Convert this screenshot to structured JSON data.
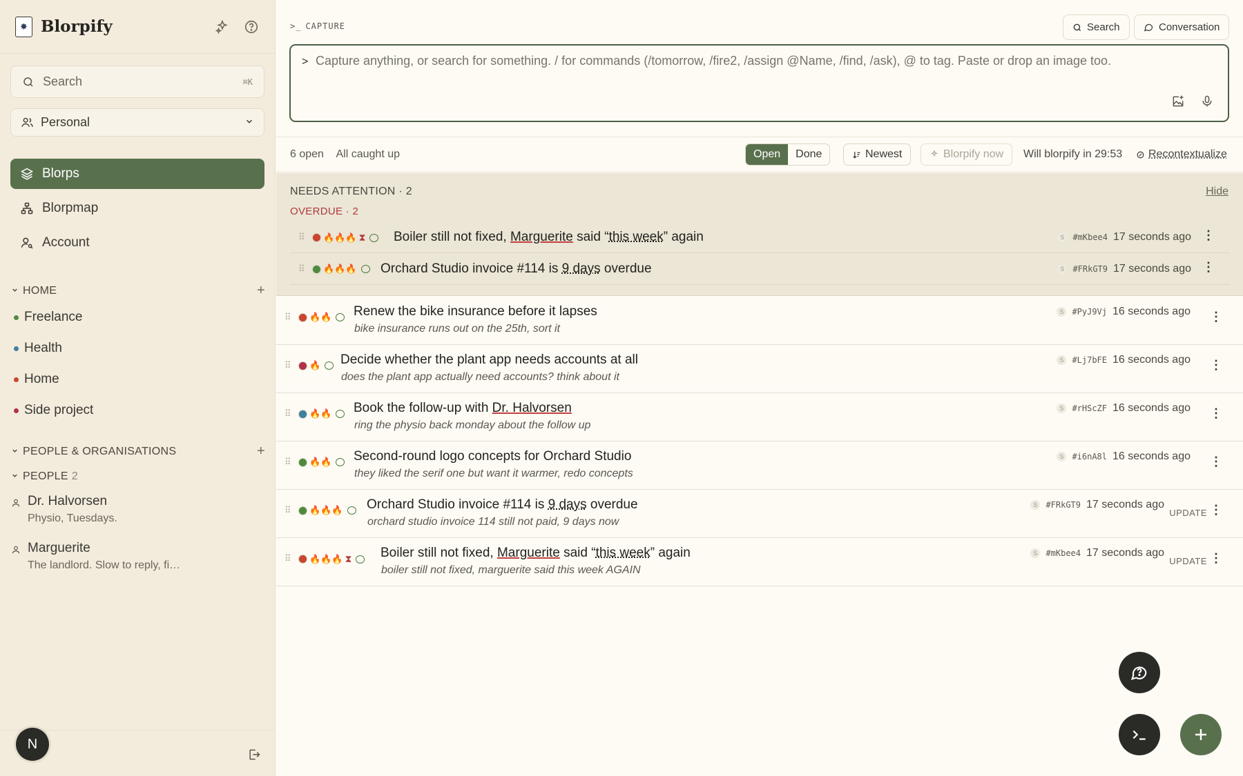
{
  "app": {
    "name": "Blorpify",
    "logo_glyph": "✸"
  },
  "sidebar": {
    "search": {
      "label": "Search",
      "shortcut": "⌘K"
    },
    "workspace": "Personal",
    "nav": [
      {
        "label": "Blorps"
      },
      {
        "label": "Blorpmap"
      },
      {
        "label": "Account"
      }
    ],
    "home_section": "HOME",
    "projects": [
      {
        "label": "Freelance",
        "color": "#4e8a3e"
      },
      {
        "label": "Health",
        "color": "#3f7fa0"
      },
      {
        "label": "Home",
        "color": "#c9452f"
      },
      {
        "label": "Side project",
        "color": "#b23048"
      }
    ],
    "people_orgs_section": "PEOPLE & ORGANISATIONS",
    "people_section": "PEOPLE",
    "people_count": "2",
    "people": [
      {
        "name": "Dr. Halvorsen",
        "desc": "Physio, Tuesdays."
      },
      {
        "name": "Marguerite",
        "desc": "The landlord. Slow to reply, fi…"
      }
    ],
    "avatar_initial": "N"
  },
  "main": {
    "capture_label": "CAPTURE",
    "search_btn": "Search",
    "conversation_btn": "Conversation",
    "prompt": ">",
    "placeholder": "Capture anything, or search for something. / for commands (/tomorrow, /fire2, /assign @Name, /find, /ask), @ to tag. Paste or drop an image too.",
    "toolbar": {
      "open_count": "6 open",
      "status": "All caught up",
      "open": "Open",
      "done": "Done",
      "sort": "Newest",
      "blorpify_now": "Blorpify now",
      "countdown": "Will blorpify in 29:53",
      "recontext": "Recontextualize"
    },
    "attention": {
      "title": "NEEDS ATTENTION · 2",
      "hide": "Hide",
      "overdue": "OVERDUE · 2",
      "items": [
        {
          "t1": "Boiler still not fixed, ",
          "t2": "Marguerite",
          "t3": " said “",
          "t4": "this week",
          "t5": "” again",
          "id": "#mKbee4",
          "time": "17 seconds ago",
          "dot": "#c9452f",
          "fires": "🔥🔥🔥",
          "hourglass": true
        },
        {
          "t1": "Orchard Studio invoice #114 is ",
          "t2": "",
          "t3": "",
          "t4": "9 days",
          "t5": " overdue",
          "id": "#FRkGT9",
          "time": "17 seconds ago",
          "dot": "#4e8a3e",
          "fires": "🔥🔥🔥",
          "hourglass": false
        }
      ]
    },
    "rows": [
      {
        "t1": "Renew the bike insurance before it lapses",
        "t2": "",
        "t3": "",
        "t4": "",
        "t5": "",
        "sub": "bike insurance runs out on the 25th, sort it",
        "id": "#PyJ9Vj",
        "time": "16 seconds ago",
        "dot": "#c9452f",
        "fires": "🔥🔥",
        "hourglass": false,
        "update": ""
      },
      {
        "t1": "Decide whether the plant app needs accounts at all",
        "t2": "",
        "t3": "",
        "t4": "",
        "t5": "",
        "sub": "does the plant app actually need accounts? think about it",
        "id": "#Lj7bFE",
        "time": "16 seconds ago",
        "dot": "#b23048",
        "fires": "🔥",
        "hourglass": false,
        "update": ""
      },
      {
        "t1": "Book the follow-up with ",
        "t2": "Dr. Halvorsen",
        "t3": "",
        "t4": "",
        "t5": "",
        "sub": "ring the physio back monday about the follow up",
        "id": "#rHScZF",
        "time": "16 seconds ago",
        "dot": "#3f7fa0",
        "fires": "🔥🔥",
        "hourglass": false,
        "update": ""
      },
      {
        "t1": "Second-round logo concepts for Orchard Studio",
        "t2": "",
        "t3": "",
        "t4": "",
        "t5": "",
        "sub": "they liked the serif one but want it warmer, redo concepts",
        "id": "#i6nA8l",
        "time": "16 seconds ago",
        "dot": "#4e8a3e",
        "fires": "🔥🔥",
        "hourglass": false,
        "update": ""
      },
      {
        "t1": "Orchard Studio invoice #114 is ",
        "t2": "",
        "t3": "",
        "t4": "9 days",
        "t5": " overdue",
        "sub": "orchard studio invoice 114 still not paid, 9 days now",
        "id": "#FRkGT9",
        "time": "17 seconds ago",
        "dot": "#4e8a3e",
        "fires": "🔥🔥🔥",
        "hourglass": false,
        "update": "UPDATE"
      },
      {
        "t1": "Boiler still not fixed, ",
        "t2": "Marguerite",
        "t3": " said “",
        "t4": "this week",
        "t5": "” again",
        "sub": "boiler still not fixed, marguerite said this week AGAIN",
        "id": "#mKbee4",
        "time": "17 seconds ago",
        "dot": "#c9452f",
        "fires": "🔥🔥🔥",
        "hourglass": true,
        "update": "UPDATE"
      }
    ],
    "meta_s": "S",
    "hourglass_glyph": "⧗"
  }
}
